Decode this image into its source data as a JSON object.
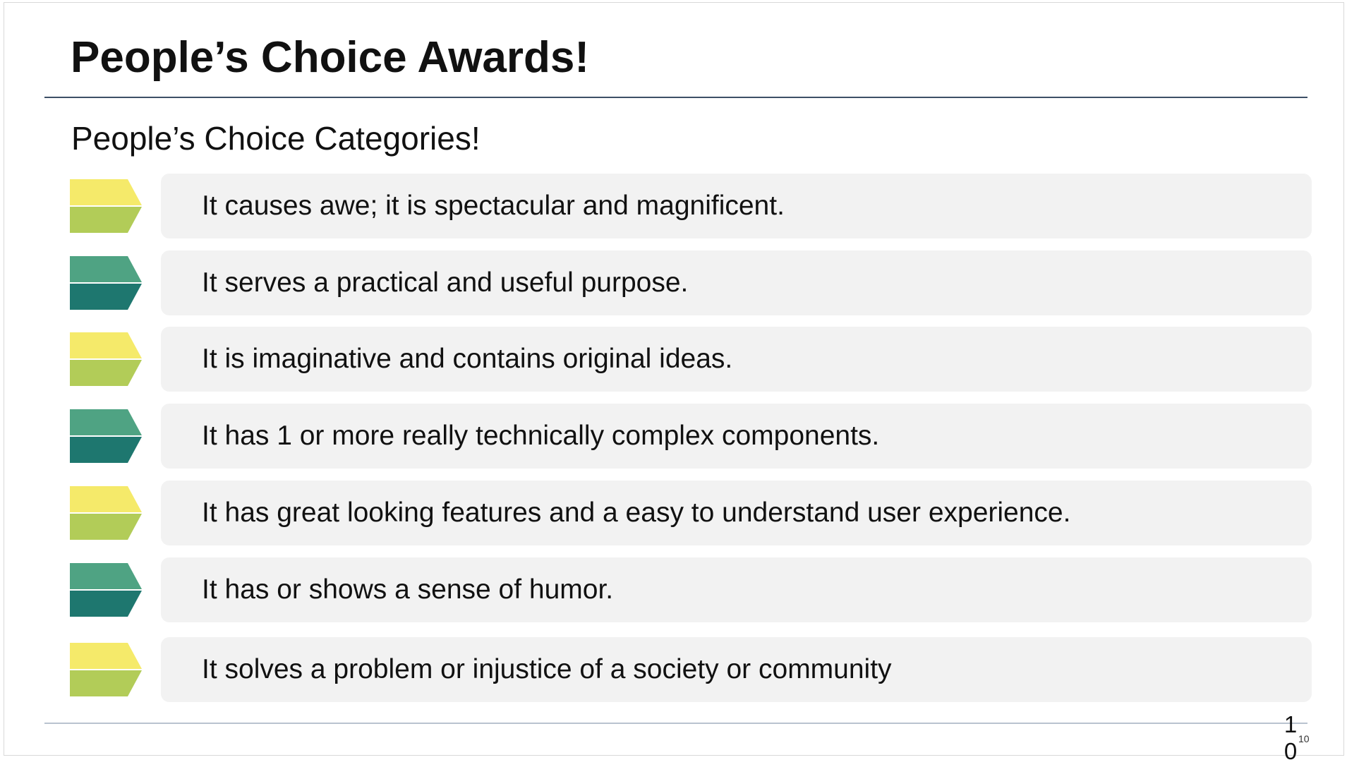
{
  "slide": {
    "title": "People’s Choice Awards!",
    "subtitle": "People’s Choice Categories!",
    "page_number": "10",
    "page_number_small": "10"
  },
  "colors": {
    "yellow_top": "#f5ea6a",
    "yellow_bottom": "#b2cc58",
    "teal_top": "#4fa383",
    "teal_bottom": "#1e776f",
    "box_bg": "#f2f2f2",
    "rule_top": "#3d4f66",
    "rule_bottom": "#b9c3cf"
  },
  "categories": [
    {
      "text": "It causes awe; it is spectacular and magnificent.",
      "icon": "yellow-chevron-icon"
    },
    {
      "text": "It serves a practical and useful purpose.",
      "icon": "teal-chevron-icon"
    },
    {
      "text": "It is imaginative and contains original ideas.",
      "icon": "yellow-chevron-icon"
    },
    {
      "text": "It has 1 or more really technically complex components.",
      "icon": "teal-chevron-icon"
    },
    {
      "text": "It has great looking features and a easy to understand user experience.",
      "icon": "yellow-chevron-icon"
    },
    {
      "text": "It has or shows a sense of humor.",
      "icon": "teal-chevron-icon"
    },
    {
      "text": "It solves a problem or injustice of a society or community",
      "icon": "yellow-chevron-icon"
    }
  ]
}
